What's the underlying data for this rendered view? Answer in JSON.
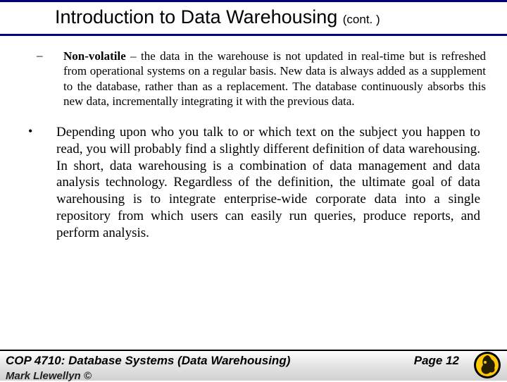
{
  "title": {
    "main": "Introduction to Data Warehousing",
    "cont": "(cont. )"
  },
  "sub_bullet": {
    "dash": "–",
    "term": "Non-volatile",
    "rest": " – the data in the warehouse is not updated in real-time but is refreshed from operational systems on a regular basis.  New data is always added as a supplement to the database, rather than as a replacement.  The database continuously absorbs this new data, incrementally integrating it with the previous data."
  },
  "main_bullet": {
    "dot": "•",
    "text": "Depending upon who you talk to or which text on the subject you happen to read, you will probably find a slightly different definition of data warehousing.    In short, data warehousing is a combination of data management and data analysis technology.  Regardless of the definition, the ultimate goal of data warehousing is to integrate enterprise-wide corporate data into a single repository from which users can easily run queries, produce reports, and perform analysis."
  },
  "footer": {
    "course": "COP 4710: Database Systems  (Data Warehousing)",
    "page": "Page 12",
    "byline": "Mark Llewellyn ©"
  }
}
